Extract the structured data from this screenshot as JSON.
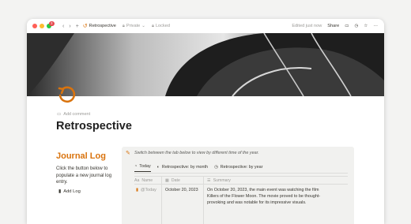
{
  "titlebar": {
    "badge": "3",
    "page_name": "Retrospective",
    "privacy": "Private",
    "lock": "Locked",
    "edited": "Edited just now",
    "share": "Share"
  },
  "page": {
    "add_comment": "Add comment",
    "title": "Retrospective"
  },
  "journal": {
    "title": "Journal Log",
    "description": "Click the button below to populate a new journal log entry.",
    "add_button": "Add Log"
  },
  "callout": {
    "text": "Switch between the tab below to view by different time of the year.",
    "tabs": [
      {
        "label": "Today"
      },
      {
        "label": "Retrospective: by month"
      },
      {
        "label": "Retrospective: by year"
      }
    ],
    "columns": [
      "Name",
      "Date",
      "Summary"
    ],
    "rows": [
      {
        "name": "@Today",
        "date": "October 20, 2023",
        "summary": "On October 20, 2023, the main event was watching the film Killers of the Flower Moon. The movie proved to be thought-provoking and was notable for its impressive visuals."
      }
    ]
  },
  "colors": {
    "accent": "#d9730d",
    "close": "#ff5f57",
    "minimize": "#febc2e",
    "maximize": "#28c840"
  }
}
